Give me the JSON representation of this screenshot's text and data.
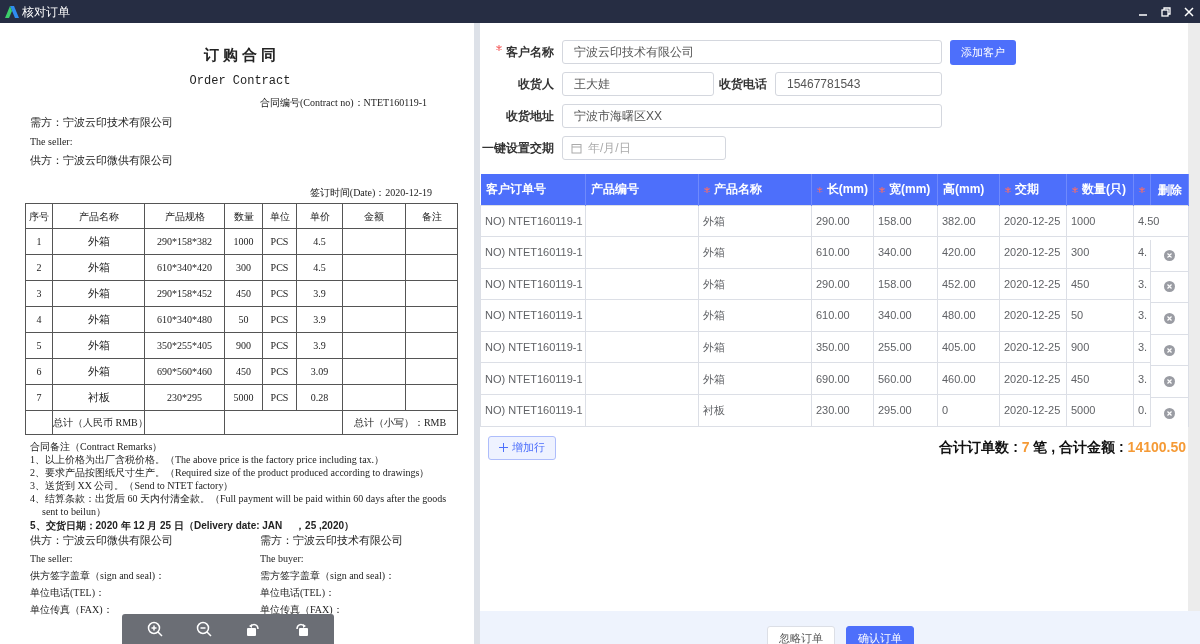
{
  "window": {
    "title": "核对订单"
  },
  "contract": {
    "title": "订 购 合 同",
    "subtitle": "Order Contract",
    "contract_no": "合同编号(Contract no)：NTET160119-1",
    "buyer": "需方：宁波云印技术有限公司",
    "seller_en": "The seller:",
    "seller": "供方：宁波云印微供有限公司",
    "date": "签订时间(Date)：2020-12-19",
    "table": {
      "columns": [
        "序号",
        "产品名称",
        "产品规格",
        "数量",
        "单位",
        "单价",
        "金额",
        "备注"
      ],
      "rows": [
        [
          "1",
          "外箱",
          "290*158*382",
          "1000",
          "PCS",
          "4.5"
        ],
        [
          "2",
          "外箱",
          "610*340*420",
          "300",
          "PCS",
          "4.5"
        ],
        [
          "3",
          "外箱",
          "290*158*452",
          "450",
          "PCS",
          "3.9"
        ],
        [
          "4",
          "外箱",
          "610*340*480",
          "50",
          "PCS",
          "3.9"
        ],
        [
          "5",
          "外箱",
          "350*255*405",
          "900",
          "PCS",
          "3.9"
        ],
        [
          "6",
          "外箱",
          "690*560*460",
          "450",
          "PCS",
          "3.09"
        ],
        [
          "7",
          "衬板",
          "230*295",
          "5000",
          "PCS",
          "0.28"
        ]
      ],
      "total_label": "总计（人民币 RMB）",
      "total_small": "总计（小写）：RMB"
    },
    "remarks_title": "合同备注（Contract Remarks）",
    "remarks": [
      {
        "text": "1、以上价格为出厂含税价格。（The above price is the factory price including tax.）",
        "bold": false
      },
      {
        "text": "2、要求产品按图纸尺寸生产。（Required size of the product produced according to drawings）",
        "bold": false
      },
      {
        "text": "3、送货到 XX 公司。（Send to NTET factory）",
        "bold": false
      },
      {
        "text": "4、结算条款：出货后 60 天内付清全款。（Full payment will be paid within 60 days after the goods sent to beilun）",
        "bold": false
      },
      {
        "text": "5、交货日期：2020 年 12 月 25 日（Delivery date: JAN　 ，25 ,2020）",
        "bold": true
      }
    ],
    "signatures": [
      [
        "供方：宁波云印微供有限公司",
        "需方：宁波云印技术有限公司"
      ],
      [
        "The seller:",
        "The buyer:"
      ],
      [
        "供方签字盖章（sign and seal)：",
        "需方签字盖章（sign and seal)："
      ],
      [
        "单位电话(TEL)：",
        "单位电话(TEL)："
      ],
      [
        "单位传真（FAX)：",
        "单位传真（FAX)："
      ]
    ]
  },
  "form": {
    "customer": {
      "label": "客户名称",
      "required": true,
      "value": "宁波云印技术有限公司"
    },
    "add_customer_button": "添加客户",
    "receiver": {
      "label": "收货人",
      "required": false,
      "value": "王大娃"
    },
    "phone": {
      "label": "收货电话",
      "required": false,
      "value": "15467781543"
    },
    "address": {
      "label": "收货地址",
      "required": false,
      "value": "宁波市海曙区XX"
    },
    "delivery_date": {
      "label": "一键设置交期",
      "required": false,
      "placeholder": "年/月/日"
    }
  },
  "order_table": {
    "columns": [
      {
        "label": "客户订单号",
        "required": false
      },
      {
        "label": "产品编号",
        "required": false
      },
      {
        "label": "产品名称",
        "required": true
      },
      {
        "label": "长(mm)",
        "required": true
      },
      {
        "label": "宽(mm)",
        "required": true
      },
      {
        "label": "高(mm)",
        "required": false
      },
      {
        "label": "交期",
        "required": true
      },
      {
        "label": "数量(只)",
        "required": true
      },
      {
        "required": true
      }
    ],
    "delete_column": "删除",
    "rows": [
      [
        "NO) NTET160119-1",
        "",
        "外箱",
        "290.00",
        "158.00",
        "382.00",
        "2020-12-25",
        "1000",
        "4.50"
      ],
      [
        "NO) NTET160119-1",
        "",
        "外箱",
        "610.00",
        "340.00",
        "420.00",
        "2020-12-25",
        "300",
        "4."
      ],
      [
        "NO) NTET160119-1",
        "",
        "外箱",
        "290.00",
        "158.00",
        "452.00",
        "2020-12-25",
        "450",
        "3."
      ],
      [
        "NO) NTET160119-1",
        "",
        "外箱",
        "610.00",
        "340.00",
        "480.00",
        "2020-12-25",
        "50",
        "3."
      ],
      [
        "NO) NTET160119-1",
        "",
        "外箱",
        "350.00",
        "255.00",
        "405.00",
        "2020-12-25",
        "900",
        "3."
      ],
      [
        "NO) NTET160119-1",
        "",
        "外箱",
        "690.00",
        "560.00",
        "460.00",
        "2020-12-25",
        "450",
        "3."
      ],
      [
        "NO) NTET160119-1",
        "",
        "衬板",
        "230.00",
        "295.00",
        "0",
        "2020-12-25",
        "5000",
        "0."
      ]
    ]
  },
  "add_row_button": "增加行",
  "summary": {
    "count_label": "合计订单数 :",
    "count": "7",
    "amount_label": "笔 , 合计金额 :",
    "amount": "14100.50"
  },
  "footer_buttons": [
    {
      "label": "忽略订单",
      "kind": "default"
    },
    {
      "label": "确认订单",
      "kind": "primary"
    }
  ]
}
